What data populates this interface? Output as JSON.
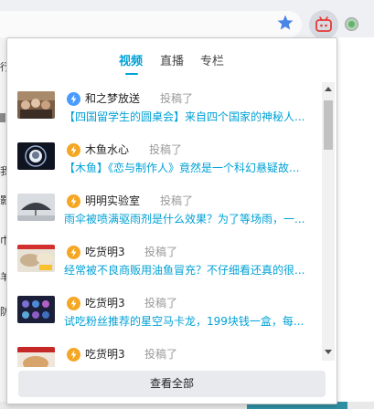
{
  "extensions": {
    "bookmark_icon": "star-icon",
    "active_icon": "bilibili-tv-icon",
    "other_icon": "green-dot-icon"
  },
  "colors": {
    "accent": "#00a1d6",
    "bolt_blue": "#4a9bff",
    "bolt_orange": "#f5a623"
  },
  "tabs": [
    {
      "label": "视频",
      "active": true
    },
    {
      "label": "直播",
      "active": false
    },
    {
      "label": "专栏",
      "active": false
    }
  ],
  "items": [
    {
      "name": "和之梦放送",
      "action": "投稿了",
      "title": "【四国留学生的圆桌会】来自四个国家的神秘人...",
      "badge": "blue"
    },
    {
      "name": "木鱼水心",
      "action": "投稿了",
      "title": "【木鱼】《恋与制作人》竟然是一个科幻悬疑故...",
      "badge": "orange"
    },
    {
      "name": "明明实验室",
      "action": "投稿了",
      "title": "雨伞被喷满驱雨剂是什么效果？为了等场雨，一...",
      "badge": "orange"
    },
    {
      "name": "吃货明3",
      "action": "投稿了",
      "title": "经常被不良商贩用油鱼冒充？不仔细看还真的很...",
      "badge": "orange"
    },
    {
      "name": "吃货明3",
      "action": "投稿了",
      "title": "试吃粉丝推荐的星空马卡龙，199块钱一盒，每...",
      "badge": "orange"
    },
    {
      "name": "吃货明3",
      "action": "投稿了",
      "title": "",
      "badge": "orange"
    }
  ],
  "view_all": "查看全部"
}
